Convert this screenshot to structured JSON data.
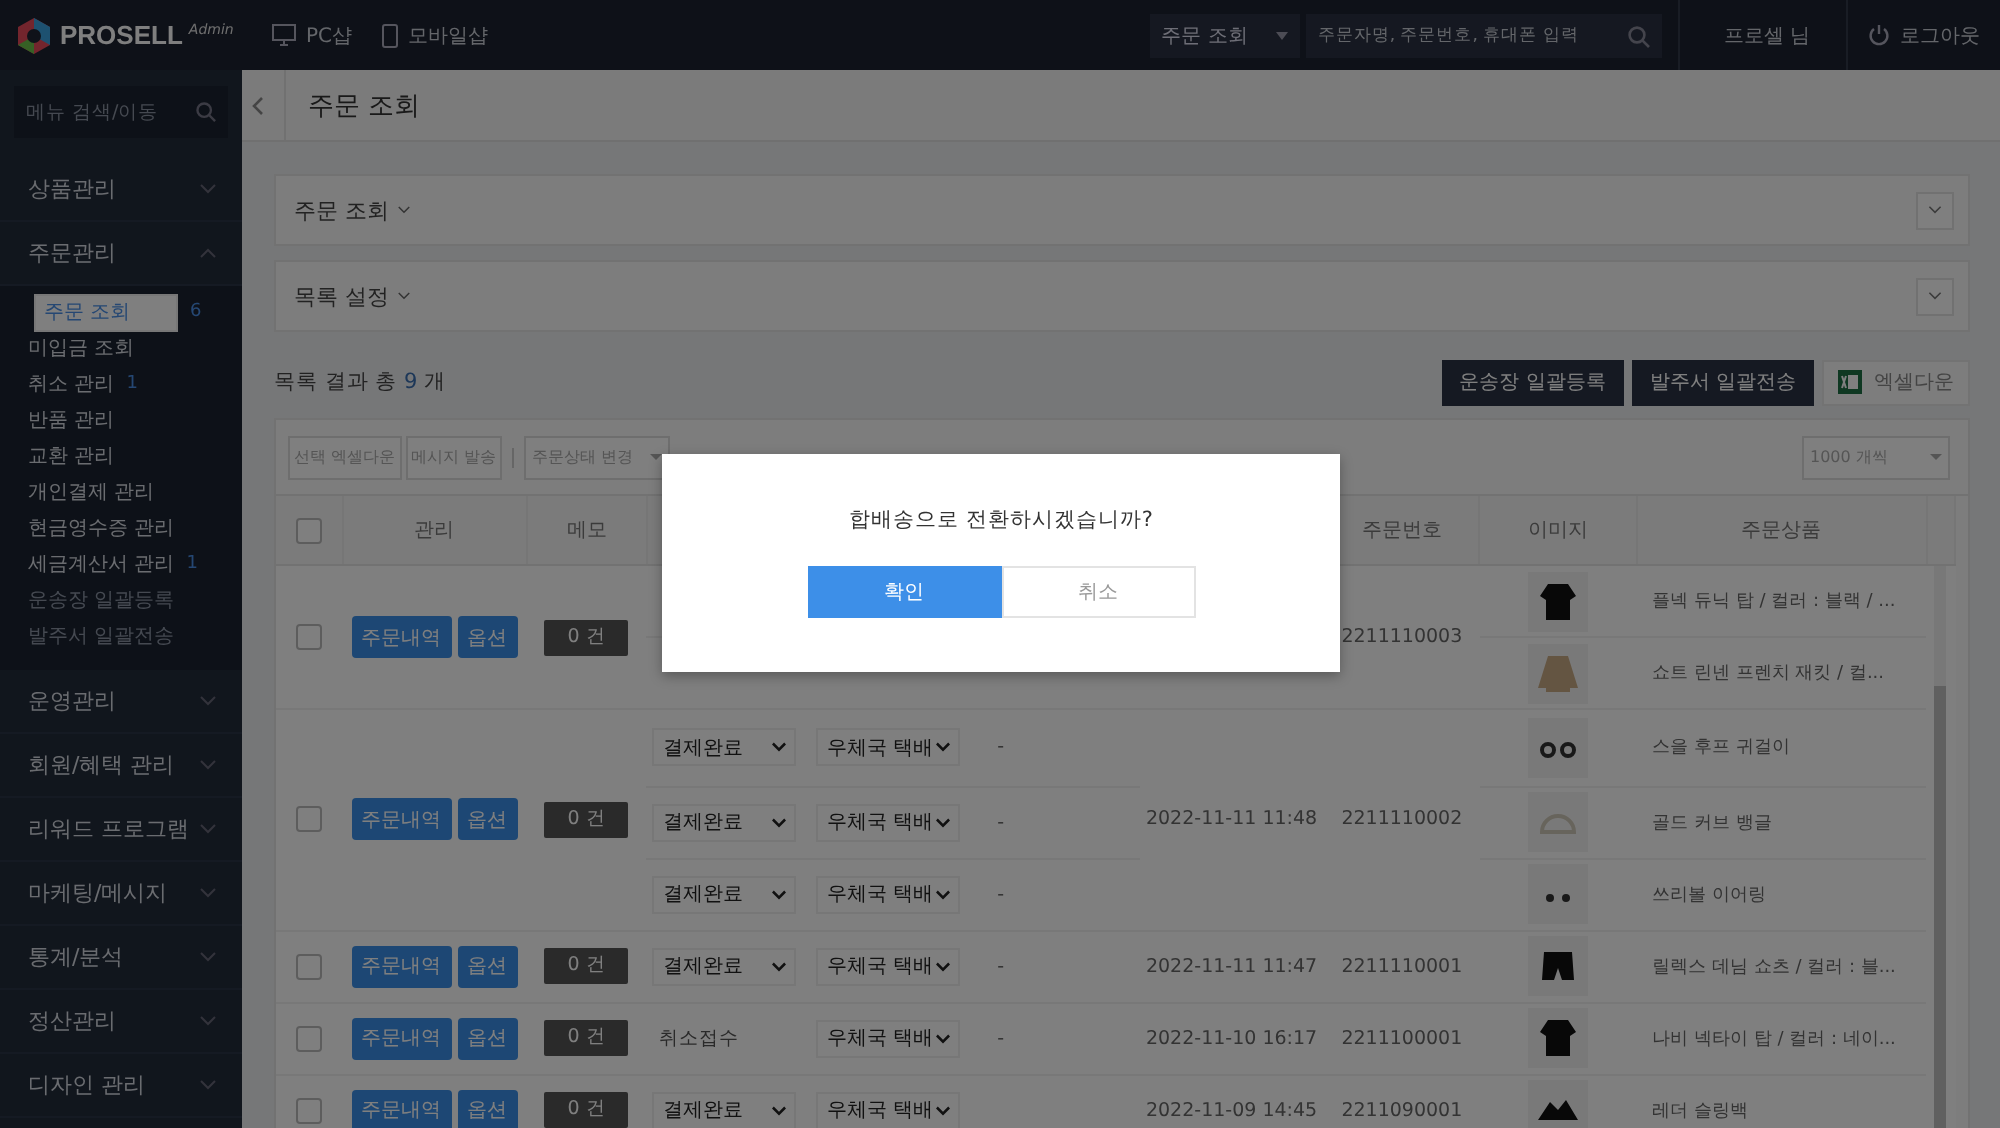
{
  "topbar": {
    "logo": "PROSELL",
    "logo_sub": "Admin",
    "links": [
      "PC샵",
      "모바일샵"
    ],
    "search_scope": "주문 조회",
    "search_placeholder": "주문자명, 주문번호, 휴대폰 입력",
    "user": "프로셀 님",
    "logout": "로그아웃"
  },
  "sidebar": {
    "search_placeholder": "메뉴 검색/이동",
    "menus": [
      {
        "label": "상품관리",
        "expanded": false
      },
      {
        "label": "주문관리",
        "expanded": true,
        "children": [
          {
            "label": "주문 조회",
            "badge": "6",
            "selected": true,
            "disabled": false
          },
          {
            "label": "미입금 조회",
            "selected": false,
            "disabled": false
          },
          {
            "label": "취소 관리",
            "badge": "1",
            "selected": false,
            "disabled": false
          },
          {
            "label": "반품 관리",
            "selected": false,
            "disabled": false
          },
          {
            "label": "교환 관리",
            "selected": false,
            "disabled": false
          },
          {
            "label": "개인결제 관리",
            "selected": false,
            "disabled": false
          },
          {
            "label": "현금영수증 관리",
            "selected": false,
            "disabled": false
          },
          {
            "label": "세금계산서 관리",
            "badge": "1",
            "selected": false,
            "disabled": false
          },
          {
            "label": "운송장 일괄등록",
            "selected": false,
            "disabled": true
          },
          {
            "label": "발주서 일괄전송",
            "selected": false,
            "disabled": true
          }
        ]
      },
      {
        "label": "운영관리",
        "expanded": false
      },
      {
        "label": "회원/혜택 관리",
        "expanded": false
      },
      {
        "label": "리워드 프로그램",
        "expanded": false
      },
      {
        "label": "마케팅/메시지",
        "expanded": false
      },
      {
        "label": "통계/분석",
        "expanded": false
      },
      {
        "label": "정산관리",
        "expanded": false
      },
      {
        "label": "디자인 관리",
        "expanded": false
      }
    ]
  },
  "page_title": "주문 조회",
  "panels": [
    {
      "title": "주문 조회",
      "expanded": false
    },
    {
      "title": "목록 설정",
      "expanded": false
    }
  ],
  "result": {
    "prefix": "목록 결과 총",
    "count": "9",
    "suffix": "개"
  },
  "actions": [
    {
      "label": "운송장 일괄등록",
      "kind": "dark"
    },
    {
      "label": "발주서 일괄전송",
      "kind": "dark"
    },
    {
      "label": "엑셀다운",
      "kind": "excel"
    }
  ],
  "toolbar": {
    "buttons": [
      "선택 엑셀다운",
      "메시지 발송"
    ],
    "status_select": "주문상태 변경",
    "page_size": "1000 개씩"
  },
  "table": {
    "header_checked": false,
    "columns": [
      "관리",
      "메모",
      "",
      "",
      "",
      "",
      "주문번호",
      "이미지",
      "주문상품"
    ],
    "orders": [
      {
        "checked": false,
        "buttons": [
          "주문내역",
          "옵션"
        ],
        "memo": "0 건",
        "number": "2211110003",
        "items": [
          {
            "product": "플넥 듀닉 탑 / 컬러 : 블랙 / ..."
          },
          {
            "product": "쇼트 린넨 프렌치 재킷 / 컬..."
          }
        ]
      },
      {
        "checked": false,
        "buttons": [
          "주문내역",
          "옵션"
        ],
        "memo": "0 건",
        "date": "2022-11-11 11:48",
        "number": "2211110002",
        "items": [
          {
            "status": {
              "kind": "select",
              "value": "결제완료"
            },
            "courier": "우체국 택배",
            "dash": "-",
            "product": "스을 후프 귀걸이"
          },
          {
            "status": {
              "kind": "select",
              "value": "결제완료"
            },
            "courier": "우체국 택배",
            "dash": "-",
            "product": "골드 커브 뱅글"
          },
          {
            "status": {
              "kind": "select",
              "value": "결제완료"
            },
            "courier": "우체국 택배",
            "dash": "-",
            "product": "쓰리볼 이어링"
          }
        ]
      },
      {
        "checked": false,
        "buttons": [
          "주문내역",
          "옵션"
        ],
        "memo": "0 건",
        "date": "2022-11-11 11:47",
        "number": "2211110001",
        "items": [
          {
            "status": {
              "kind": "select",
              "value": "결제완료"
            },
            "courier": "우체국 택배",
            "dash": "-",
            "product": "릴렉스 데님 쇼츠 / 컬러 : 블..."
          }
        ]
      },
      {
        "checked": false,
        "buttons": [
          "주문내역",
          "옵션"
        ],
        "memo": "0 건",
        "date": "2022-11-10 16:17",
        "number": "2211100001",
        "items": [
          {
            "status": {
              "kind": "text",
              "value": "취소접수"
            },
            "courier": "우체국 택배",
            "dash": "-",
            "product": "나비 넥타이 탑 / 컬러 : 네이..."
          }
        ]
      },
      {
        "checked": false,
        "buttons": [
          "주문내역",
          "옵션"
        ],
        "memo": "0 건",
        "date": "2022-11-09 14:45",
        "number": "2211090001",
        "items": [
          {
            "status": {
              "kind": "select",
              "value": "결제완료"
            },
            "courier": "우체국 택배",
            "product": "레더 슬링백"
          }
        ]
      }
    ]
  },
  "dialog": {
    "message": "합배송으로 전환하시겠습니까?",
    "confirm": "확인",
    "cancel": "취소"
  }
}
